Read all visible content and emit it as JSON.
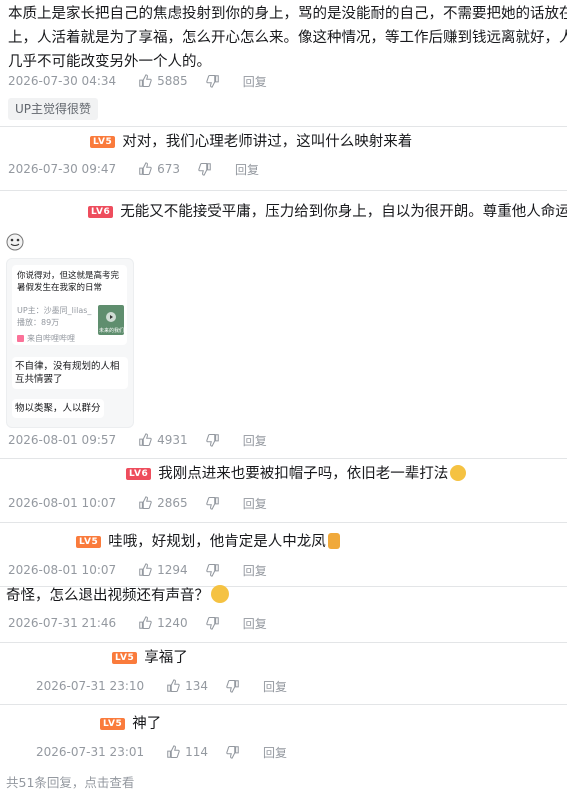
{
  "comments": [
    {
      "text": "本质上是家长把自己的焦虑投射到你的身上，骂的是没能耐的自己，不需要把她的话放在心上，人活着就是为了享福，怎么开心怎么来。像这种情况，等工作后赚到钱远离就好，人是几乎不可能改变另外一个人的。",
      "lines": [
        "本质上是家长把自己的焦虑投射到你的身上，骂的是没能耐的自己，不需要把她的话放在心",
        "上，人活着就是为了享福，怎么开心怎么来。像这种情况，等工作后赚到钱远离就好，人是",
        "几乎不可能改变另外一个人的。"
      ],
      "date": "2026-07-30 04:34",
      "likes": "5885",
      "reply": "回复",
      "badge": "UP主觉得很赞"
    },
    {
      "level": "LV5",
      "text": "对对，我们心理老师讲过，这叫什么映射来着",
      "date": "2026-07-30 09:47",
      "likes": "673",
      "reply": "回复"
    },
    {
      "level": "LV6",
      "text": "无能又不能接受平庸，压力给到你身上，自以为很开朗。尊重他人命运",
      "date": "2026-08-01 09:57",
      "likes": "4931",
      "reply": "回复",
      "card": {
        "video_title": "你说得对，但这就是高考完暑假发生在我家的日常",
        "video_up": "UP主：沙墨同_lilas_",
        "video_plays": "播放：89万",
        "thumb_text": "未来的我们！",
        "source": "来自哔哩哔哩",
        "msg1": "不自律，没有规划的人相互共情罢了",
        "msg2": "物以类聚，人以群分"
      }
    },
    {
      "level": "LV6",
      "text": "我刚点进来也要被扣帽子吗，依旧老一辈打法",
      "date": "2026-08-01 10:07",
      "likes": "2865",
      "reply": "回复"
    },
    {
      "level": "LV5",
      "text": "哇哦，好规划，他肯定是人中龙凤",
      "date": "2026-08-01 10:07",
      "likes": "1294",
      "reply": "回复"
    },
    {
      "text": "奇怪，怎么退出视频还有声音？",
      "date": "2026-07-31 21:46",
      "likes": "1240",
      "reply": "回复"
    },
    {
      "level": "LV5",
      "text": "享福了",
      "date": "2026-07-31 23:10",
      "likes": "134",
      "reply": "回复"
    },
    {
      "level": "LV5",
      "text": "神了",
      "date": "2026-07-31 23:01",
      "likes": "114",
      "reply": "回复"
    }
  ],
  "footer": {
    "total": "共51条回复，",
    "link": "点击查看"
  },
  "colors": {
    "lv5": "#fa7b3c",
    "lv6": "#ee4d5d",
    "meta": "#9499a0",
    "link": "#9499a0"
  },
  "icons": [
    "like-icon",
    "dislike-icon",
    "smiley-sticker-icon",
    "play-icon"
  ]
}
